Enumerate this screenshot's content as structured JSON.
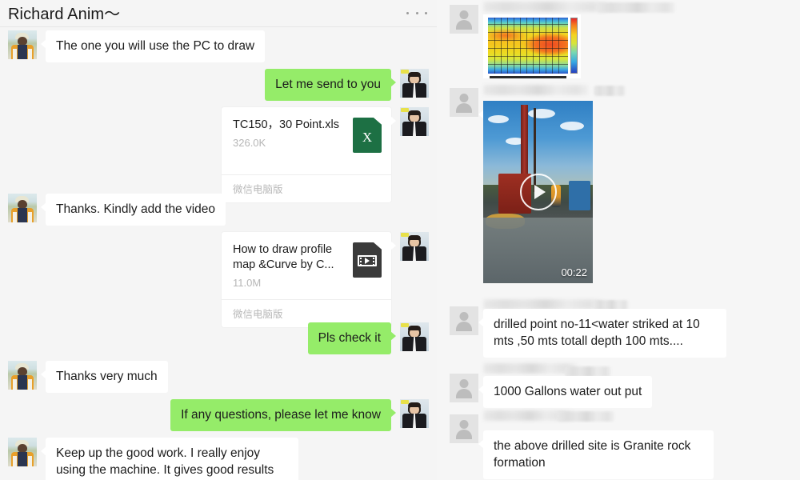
{
  "left_panel": {
    "header": {
      "title": "Richard Anim～",
      "more_icon": "more-horizontal-icon"
    },
    "messages": [
      {
        "id": "m1",
        "side": "in",
        "type": "text",
        "text": "The one you will use the PC to draw"
      },
      {
        "id": "m2",
        "side": "out",
        "type": "text",
        "text": "Let me send  to you"
      },
      {
        "id": "m3",
        "side": "out",
        "type": "file",
        "file_name": "TC150，30 Point.xls",
        "file_size": "326.0K",
        "source": "微信电脑版",
        "icon": "excel-file-icon"
      },
      {
        "id": "m4",
        "side": "in",
        "type": "text",
        "text": "Thanks. Kindly add the video"
      },
      {
        "id": "m5",
        "side": "out",
        "type": "file",
        "file_name": "How to draw profile map &Curve by C...",
        "file_size": "11.0M",
        "source": "微信电脑版",
        "icon": "video-file-icon"
      },
      {
        "id": "m6",
        "side": "out",
        "type": "text",
        "text": "Pls check it"
      },
      {
        "id": "m7",
        "side": "in",
        "type": "text",
        "text": "Thanks very much"
      },
      {
        "id": "m8",
        "side": "out",
        "type": "text",
        "text": "If any questions, please let me know"
      },
      {
        "id": "m9",
        "side": "in",
        "type": "text",
        "text": "Keep up the good work. I really enjoy using the machine.   It gives good results"
      }
    ]
  },
  "right_panel": {
    "messages": [
      {
        "id": "r1",
        "type": "image",
        "sender_name": "",
        "sender_blurred": true,
        "alt": "resistivity heat map profile chart"
      },
      {
        "id": "r2",
        "type": "video",
        "sender_name": "",
        "sender_blurred": true,
        "duration": "00:22",
        "alt": "drilling rig at borehole site with water"
      },
      {
        "id": "r3",
        "type": "text",
        "sender_name": "",
        "sender_blurred": true,
        "text": "drilled point no-11<water striked at 10 mts ,50 mts  totall depth 100 mts...."
      },
      {
        "id": "r4",
        "type": "text",
        "sender_name": "",
        "sender_blurred": true,
        "text": "1000 Gallons water out put"
      },
      {
        "id": "r5",
        "type": "text",
        "sender_name": "",
        "sender_blurred": true,
        "text": "the above drilled site is Granite rock formation"
      }
    ]
  },
  "colors": {
    "outgoing_bubble": "#95ec69",
    "incoming_bubble": "#ffffff",
    "left_panel_bg": "#f5f5f5",
    "right_panel_bg": "#f6f6f6",
    "excel_icon": "#1d7044",
    "video_icon": "#3a3a3a",
    "text_primary": "#1c1c1c",
    "text_muted": "#b6b6b6"
  }
}
